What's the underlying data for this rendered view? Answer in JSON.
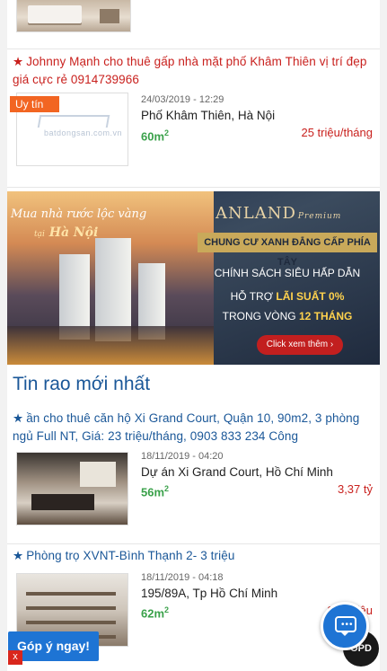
{
  "listings_top": [
    {
      "title": "Johnny Mạnh cho thuê gấp nhà mặt phố Khâm Thiên vị trí đẹp giá cực rẻ 0914739966",
      "badge": "Uy tín",
      "thumb_text": "batdongsan.com.vn",
      "date": "24/03/2019 - 12:29",
      "address": "Phố Khâm Thiên, Hà Nội",
      "area": "60m",
      "area_unit_sup": "2",
      "price": "25 triệu/tháng"
    }
  ],
  "banner": {
    "slogan": "Mua nhà rước lộc vàng",
    "city_prefix": "tại",
    "city": "Hà Nội",
    "brand": "ANLAND",
    "brand_suffix": "Premium",
    "tagline": "CHUNG CƯ XANH ĐẲNG CẤP PHÍA TÂY",
    "line1": "CHÍNH SÁCH SIÊU HẤP DẪN",
    "line2_prefix": "HỖ TRỢ",
    "line2_highlight": "LÃI SUẤT 0%",
    "line3_prefix": "TRONG VÒNG",
    "line3_highlight": "12 THÁNG",
    "cta": "Click xem thêm ›"
  },
  "section_title": "Tin rao mới nhất",
  "listings_new": [
    {
      "title": "ần cho thuê căn hộ Xi Grand Court, Quận 10, 90m2, 3 phòng ngủ Full NT, Giá: 23 triệu/tháng, 0903 833 234 Công",
      "date": "18/11/2019 - 04:20",
      "address": "Dự án Xi Grand Court, Hồ Chí Minh",
      "area": "56m",
      "area_unit_sup": "2",
      "price": "3,37 tỷ"
    },
    {
      "title": "Phòng trọ XVNT-Bình Thạnh 2- 3 triệu",
      "date": "18/11/2019 - 04:18",
      "address": "195/89A, Tp Hồ Chí Minh",
      "area": "62m",
      "area_unit_sup": "2",
      "price": "233 triệu"
    }
  ],
  "star": "★",
  "feedback_label": "Góp ý ngay!",
  "close_label": "x",
  "scroll_top_label": "OPD",
  "icons": {
    "chat": "chat-bubble-icon",
    "star": "star-icon"
  },
  "colors": {
    "vip_title": "#c9211e",
    "normal_title": "#1a5798",
    "area": "#3aa14a",
    "price": "#c9211e",
    "badge": "#f26522",
    "accent": "#1e74d4"
  }
}
